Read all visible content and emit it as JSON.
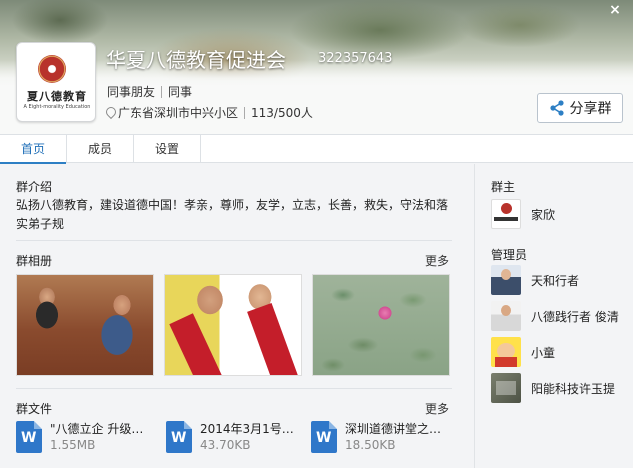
{
  "window": {
    "close_glyph": "×"
  },
  "header": {
    "group_name": "华夏八德教育促进会",
    "group_id": "322357643",
    "logo_text": "夏八德教育",
    "logo_subtext": "A Eight-morality Education",
    "tags": [
      "同事朋友",
      "同事"
    ],
    "location": "广东省深圳市中兴小区",
    "member_count": "113/500人",
    "share_label": "分享群"
  },
  "tabs": [
    {
      "label": "首页",
      "active": true
    },
    {
      "label": "成员",
      "active": false
    },
    {
      "label": "设置",
      "active": false
    }
  ],
  "intro": {
    "title": "群介绍",
    "text": "弘扬八德教育，建设道德中国！孝亲，尊师，友学，立志，长善，救失，守法和落实弟子规"
  },
  "album": {
    "title": "群相册",
    "more": "更多",
    "photos": [
      "photo-1",
      "photo-2",
      "photo-3"
    ]
  },
  "files": {
    "title": "群文件",
    "more": "更多",
    "items": [
      {
        "name": "\"八德立企  升级…",
        "size": "1.55MB",
        "icon": "word-icon"
      },
      {
        "name": "2014年3月1号…",
        "size": "43.70KB",
        "icon": "word-icon"
      },
      {
        "name": "深圳道德讲堂之…",
        "size": "18.50KB",
        "icon": "word-icon"
      }
    ]
  },
  "sidebar": {
    "owner_title": "群主",
    "owner": {
      "name": "家欣"
    },
    "admins_title": "管理员",
    "admins": [
      {
        "name": "天和行者"
      },
      {
        "name": "八德践行者  俊清"
      },
      {
        "name": "小童"
      },
      {
        "name": "阳能科技许玉提"
      }
    ]
  },
  "colors": {
    "accent": "#2d7fc4",
    "word_icon": "#2f77c9",
    "sash_red": "#c41e2a"
  }
}
